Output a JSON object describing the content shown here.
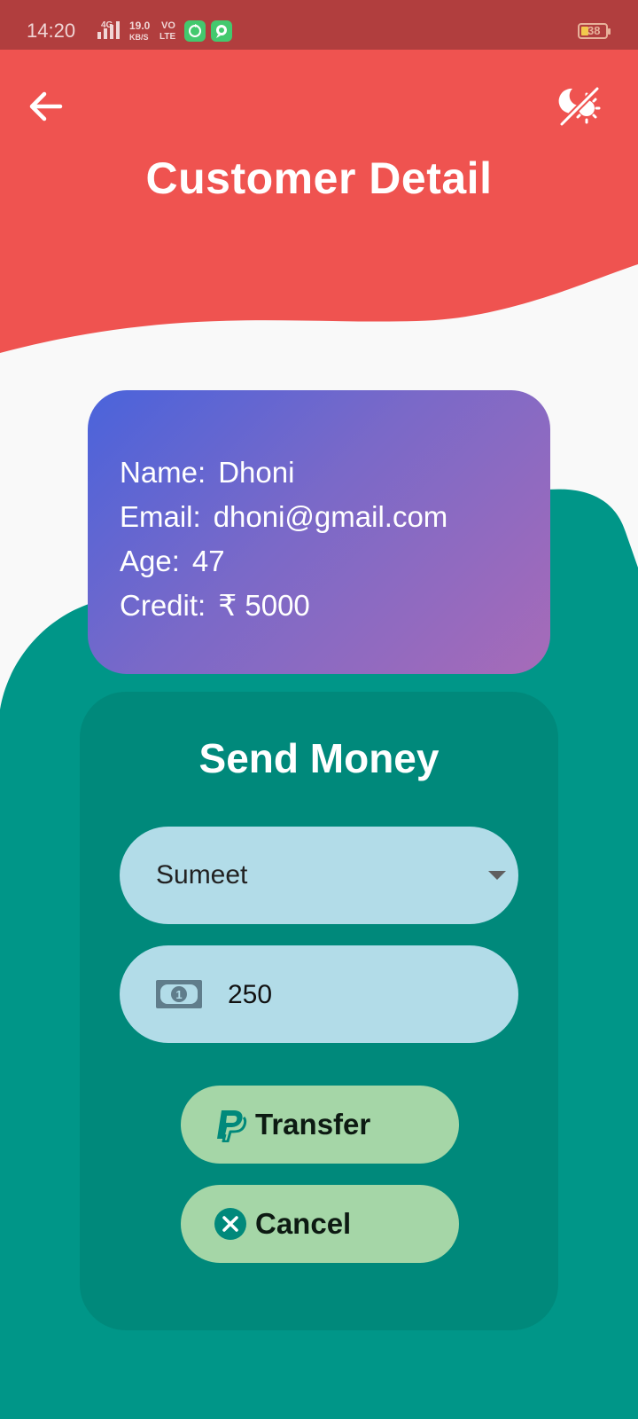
{
  "status_bar": {
    "time": "14:20",
    "network": "4G",
    "speed_value": "19.0",
    "speed_unit": "KB/S",
    "volte_top": "VO",
    "volte_bottom": "LTE",
    "battery": "38"
  },
  "colors": {
    "header": "#ef5350",
    "status_bar": "#b13e3e",
    "teal_background": "#009688",
    "panel": "#00897b",
    "input_fill": "#b2dce8",
    "button_fill": "#a5d6a7"
  },
  "header": {
    "back_icon": "arrow-left-icon",
    "theme_icon": "theme-toggle-icon",
    "title": "Customer Detail"
  },
  "customer": {
    "name_label": "Name:",
    "name": "Dhoni",
    "email_label": "Email:",
    "email": "dhoni@gmail.com",
    "age_label": "Age:",
    "age": "47",
    "credit_label": "Credit:",
    "credit": "₹ 5000"
  },
  "send_money": {
    "title": "Send Money",
    "recipient_selected": "Sumeet",
    "amount_icon": "money-bill-icon",
    "amount_value": "250",
    "transfer_label": "Transfer",
    "transfer_icon": "paypal-icon",
    "cancel_label": "Cancel",
    "cancel_icon": "cancel-circle-icon"
  }
}
